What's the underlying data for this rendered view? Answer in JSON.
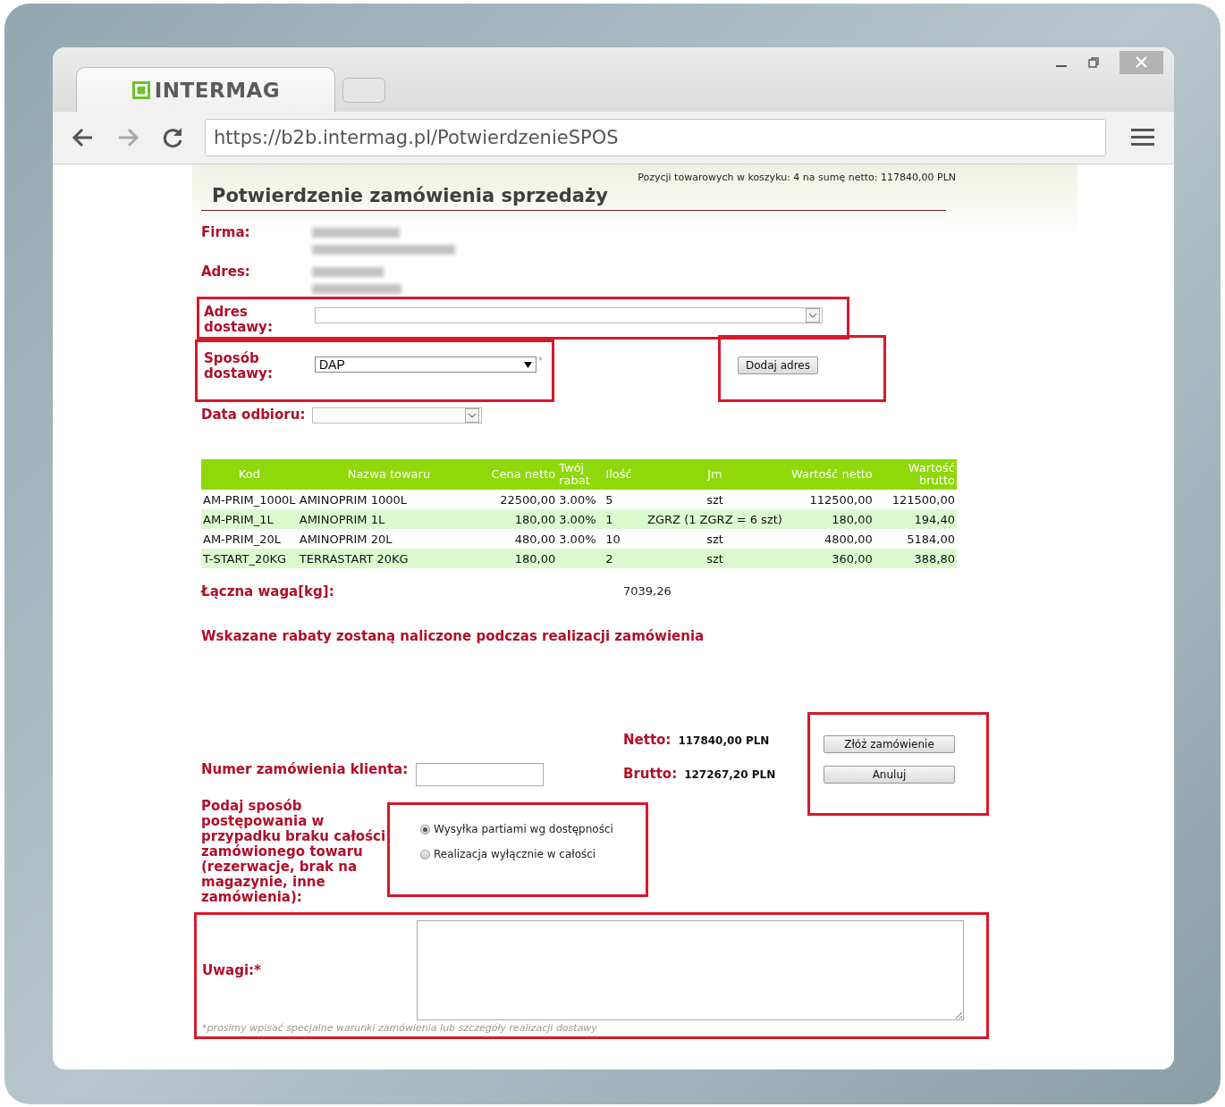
{
  "browser": {
    "tab_title": "INTERMAG",
    "url": "https://b2b.intermag.pl/PotwierdzenieSPOS"
  },
  "cart_summary": "Pozycji towarowych w koszyku: 4 na sumę netto: 117840,00 PLN",
  "title": "Potwierdzenie zamówienia sprzedaży",
  "company": {
    "label": "Firma:"
  },
  "address": {
    "label": "Adres:"
  },
  "delivery_address": {
    "label": "Adres dostawy:",
    "highlighted": true
  },
  "delivery_method": {
    "label": "Sposób dostawy:",
    "value": "DAP",
    "required_mark": "*",
    "highlighted": true
  },
  "add_address_button": {
    "label": "Dodaj adres",
    "highlighted": true
  },
  "pickup_date": {
    "label": "Data odbioru:"
  },
  "table": {
    "columns": [
      "Kod",
      "Nazwa towaru",
      "Cena netto",
      "Twój rabat",
      "Ilość",
      "Jm",
      "Wartość netto",
      "Wartość brutto"
    ],
    "rows": [
      {
        "code": "AM-PRIM_1000L",
        "name": "AMINOPRIM 1000L",
        "price": "22500,00",
        "discount": "3.00%",
        "qty": "5",
        "unit": "szt",
        "net": "112500,00",
        "gross": "121500,00"
      },
      {
        "code": "AM-PRIM_1L",
        "name": "AMINOPRIM 1L",
        "price": "180,00",
        "discount": "3.00%",
        "qty": "1",
        "unit": "ZGRZ (1 ZGRZ = 6 szt)",
        "net": "180,00",
        "gross": "194,40"
      },
      {
        "code": "AM-PRIM_20L",
        "name": "AMINOPRIM 20L",
        "price": "480,00",
        "discount": "3.00%",
        "qty": "10",
        "unit": "szt",
        "net": "4800,00",
        "gross": "5184,00"
      },
      {
        "code": "T-START_20KG",
        "name": "TERRASTART 20KG",
        "price": "180,00",
        "qty": "2",
        "unit": "szt",
        "net": "360,00",
        "gross": "388,80"
      }
    ]
  },
  "weight": {
    "label": "Łączna waga[kg]:",
    "value": "7039,26"
  },
  "discount_note": "Wskazane rabaty zostaną naliczone podczas realizacji zamówienia",
  "totals": [
    {
      "label": "Netto:",
      "value": "117840,00 PLN"
    },
    {
      "label": "Brutto:",
      "value": "127267,20 PLN"
    }
  ],
  "actions": {
    "highlighted": true,
    "buttons": [
      "Złóż zamówienie",
      "Anuluj"
    ]
  },
  "order_number": {
    "label": "Numer zamówienia klienta:"
  },
  "procedure": {
    "label": "Podaj sposób postępowania w przypadku braku całości zamówionego towaru (rezerwacje, brak na magazynie, inne zamówienia):",
    "highlighted": true,
    "options": [
      {
        "label": "Wysyłka partiami wg dostępności",
        "selected": true
      },
      {
        "label": "Realizacja wyłącznie w całości",
        "selected": false
      }
    ]
  },
  "remarks": {
    "label": "Uwagi:*",
    "hint": "*prosimy wpisać specjalne warunki zamówienia lub szczegóły realizacji dostawy",
    "highlighted": true
  }
}
